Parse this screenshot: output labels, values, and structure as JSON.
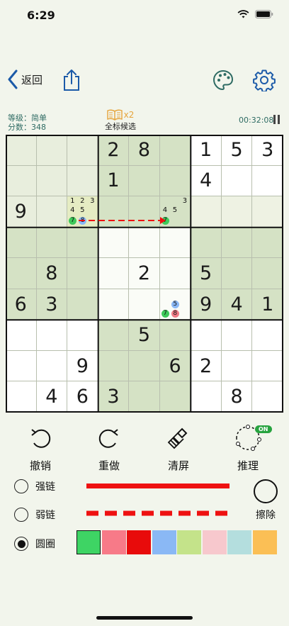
{
  "status": {
    "time": "6:29"
  },
  "nav": {
    "back_label": "返回"
  },
  "info": {
    "level": "等级：简单",
    "score": "分数：348"
  },
  "hint": {
    "count": "x2",
    "label": "全标候选"
  },
  "timer": "00:32:08",
  "grid": {
    "values": [
      [
        "",
        "",
        "",
        "2",
        "8",
        "",
        "1",
        "5",
        "3"
      ],
      [
        "",
        "",
        "",
        "1",
        "",
        "",
        "4",
        "",
        ""
      ],
      [
        "9",
        "",
        "",
        "",
        "",
        "",
        "",
        "",
        ""
      ],
      [
        "",
        "",
        "",
        "",
        "",
        "",
        "",
        "",
        ""
      ],
      [
        "",
        "8",
        "",
        "",
        "2",
        "",
        "5",
        "",
        ""
      ],
      [
        "6",
        "3",
        "",
        "",
        "",
        "",
        "9",
        "4",
        "1"
      ],
      [
        "",
        "",
        "",
        "",
        "5",
        "",
        "",
        "",
        ""
      ],
      [
        "",
        "",
        "9",
        "",
        "",
        "6",
        "2",
        "",
        ""
      ],
      [
        "",
        "4",
        "6",
        "3",
        "",
        "",
        "",
        "8",
        ""
      ]
    ],
    "candidates": {
      "r3c3": [
        "1",
        "2",
        "3",
        "4",
        "5"
      ],
      "r3c6": [
        "3",
        "4",
        "5"
      ]
    },
    "circled": {
      "r3c3": [
        {
          "n": "7",
          "color": "#3ec95a"
        },
        {
          "n": "8",
          "color": "#8ab8f5"
        }
      ],
      "r3c6": [
        {
          "n": "7",
          "color": "#3ec95a"
        }
      ],
      "r6c6": [
        {
          "n": "5",
          "color": "#8ab8f5"
        },
        {
          "n": "7",
          "color": "#3ec95a"
        },
        {
          "n": "8",
          "color": "#f07c87"
        }
      ]
    }
  },
  "tools": [
    {
      "label": "撤销",
      "icon": "undo-icon"
    },
    {
      "label": "重做",
      "icon": "redo-icon"
    },
    {
      "label": "清屏",
      "icon": "broom-icon"
    },
    {
      "label": "推理",
      "icon": "inference-icon"
    }
  ],
  "inference_badge": "ON",
  "modes": [
    {
      "label": "强链",
      "selected": false
    },
    {
      "label": "弱链",
      "selected": false
    },
    {
      "label": "圆圈",
      "selected": true
    }
  ],
  "eraser_label": "擦除",
  "swatch_colors": [
    "#3ed464",
    "#f77a88",
    "#e80b0b",
    "#8ab8f5",
    "#c4e38a",
    "#f7c8cd",
    "#b4dede",
    "#fbbf55"
  ],
  "colors": {
    "accent": "#1b5aa8",
    "teal": "#2e6b63",
    "strong_line": "#ee1111",
    "shade": "#d5e2c5",
    "highlight": "#e8eedd"
  }
}
